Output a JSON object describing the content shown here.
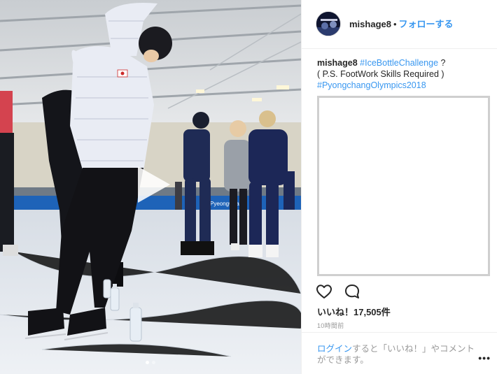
{
  "post": {
    "username": "mishage8",
    "separator": "•",
    "follow_label": "フォローする",
    "caption": {
      "username": "mishage8",
      "tag_1": "#IceBottleChallenge",
      "text_1": " ?",
      "text_2": "( P.S. FootWork Skills Required )",
      "tag_2": "#PyongchangOlympics2018"
    },
    "likes": "いいね！17,505件",
    "time": "10時間前",
    "login_link": "ログイン",
    "login_text": "すると「いいね！」やコメントができます。",
    "more_label": "•••"
  },
  "media": {
    "banner_text": "PyeongChang",
    "type": "video",
    "icons": [
      "play-icon"
    ],
    "carousel_dots": 2
  },
  "actions": {
    "icons": [
      "heart-icon",
      "comment-icon"
    ]
  },
  "colors": {
    "link": "#3897f0",
    "text": "#262626",
    "muted": "#999999",
    "border": "#efefef"
  }
}
